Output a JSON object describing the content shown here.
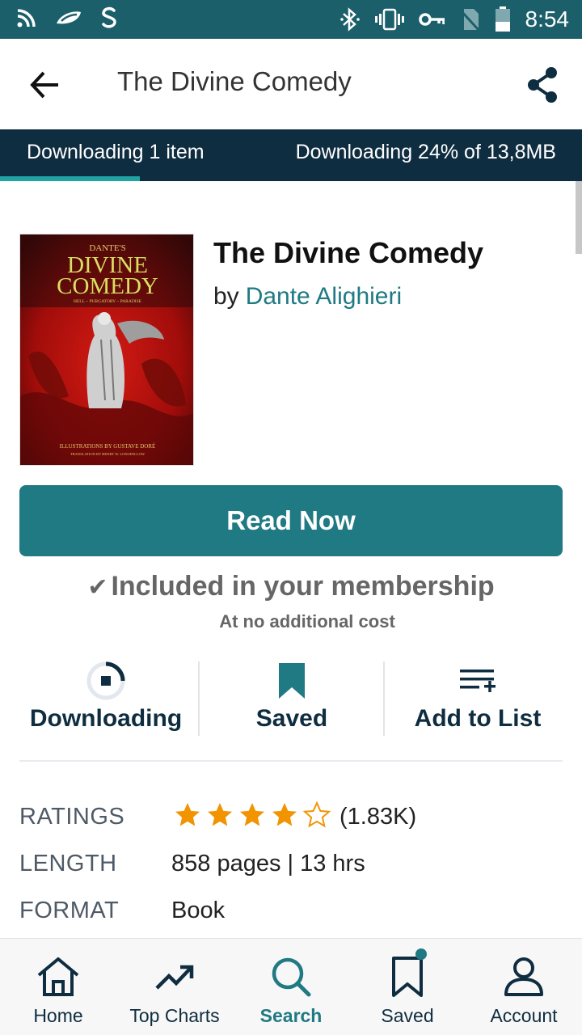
{
  "status_bar": {
    "time": "8:54",
    "left_icons": [
      "cast-icon",
      "messaging-icon",
      "sync-icon"
    ],
    "right_icons": [
      "bluetooth-icon",
      "vibrate-icon",
      "vpn-key-icon",
      "no-sim-icon",
      "battery-icon"
    ]
  },
  "app_bar": {
    "title": "The Divine Comedy",
    "back_icon": "arrow-back-icon",
    "share_icon": "share-icon"
  },
  "download_bar": {
    "left_text": "Downloading 1 item",
    "right_text": "Downloading 24% of 13,8MB",
    "progress": 0.24
  },
  "book": {
    "title": "The Divine Comedy",
    "by": "by",
    "author": "Dante Alighieri",
    "cover": {
      "small_title": "DANTE'S",
      "title_line1": "DIVINE",
      "title_line2": "COMEDY",
      "subtitle": "HELL ~ PURGATORY ~ PARADISE",
      "illustrations": "ILLUSTRATIONS BY GUSTAVE DORÉ",
      "translation": "TRANSLATION BY HENRY W. LONGFELLOW"
    }
  },
  "read_button": "Read Now",
  "membership": {
    "included": "Included in your membership",
    "no_cost": "At no additional cost"
  },
  "actions": [
    {
      "label": "Downloading",
      "icon": "download-progress-icon"
    },
    {
      "label": "Saved",
      "icon": "bookmark-icon"
    },
    {
      "label": "Add to List",
      "icon": "playlist-add-icon"
    }
  ],
  "details": {
    "ratings_label": "RATINGS",
    "rating_value": 4,
    "rating_max": 5,
    "rating_count": "(1.83K)",
    "length_label": "LENGTH",
    "length_value": "858 pages | 13 hrs",
    "format_label": "FORMAT",
    "format_value": "Book"
  },
  "colors": {
    "status_bar": "#1a5f6a",
    "accent": "#1f7a83",
    "dark_navy": "#0f2d40",
    "star": "#f29400"
  },
  "bottom_nav": [
    {
      "label": "Home",
      "icon": "home-icon",
      "active": false
    },
    {
      "label": "Top Charts",
      "icon": "trending-up-icon",
      "active": false
    },
    {
      "label": "Search",
      "icon": "search-icon",
      "active": true
    },
    {
      "label": "Saved",
      "icon": "bookmark-outline-icon",
      "active": false
    },
    {
      "label": "Account",
      "icon": "account-icon",
      "active": false
    }
  ]
}
